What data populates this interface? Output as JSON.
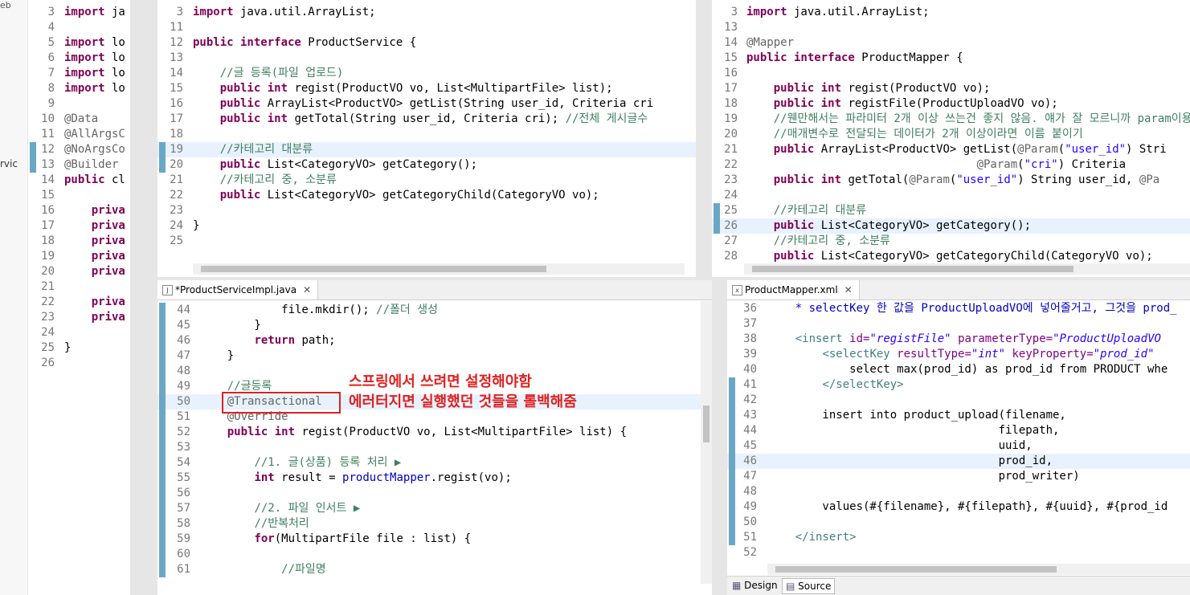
{
  "side_labels": {
    "top": "eb",
    "mid": "rvic"
  },
  "pane_a": {
    "lines": [
      {
        "n": "3",
        "t": "import ja",
        "kw": true
      },
      {
        "n": "4",
        "t": ""
      },
      {
        "n": "5",
        "t": "import lo",
        "kw": true
      },
      {
        "n": "6",
        "t": "import lo",
        "kw": true
      },
      {
        "n": "7",
        "t": "import lo",
        "kw": true
      },
      {
        "n": "8",
        "t": "import lo",
        "kw": true
      },
      {
        "n": "9",
        "t": ""
      },
      {
        "n": "10",
        "t": "@Data"
      },
      {
        "n": "11",
        "t": "@AllArgsC"
      },
      {
        "n": "12",
        "t": "@NoArgsCo"
      },
      {
        "n": "13",
        "t": "@Builder"
      },
      {
        "n": "14",
        "t": "public cl",
        "kw": true
      },
      {
        "n": "15",
        "t": ""
      },
      {
        "n": "16",
        "t": "    priva",
        "kw": true
      },
      {
        "n": "17",
        "t": "    priva",
        "kw": true
      },
      {
        "n": "18",
        "t": "    priva",
        "kw": true
      },
      {
        "n": "19",
        "t": "    priva",
        "kw": true
      },
      {
        "n": "20",
        "t": "    priva",
        "kw": true
      },
      {
        "n": "21",
        "t": ""
      },
      {
        "n": "22",
        "t": "    priva",
        "kw": true
      },
      {
        "n": "23",
        "t": "    priva",
        "kw": true
      },
      {
        "n": "24",
        "t": ""
      },
      {
        "n": "25",
        "t": "}"
      },
      {
        "n": "26",
        "t": ""
      }
    ]
  },
  "pane_b": {
    "lines": [
      {
        "n": "3",
        "h": "<span class=\"kw\">import</span> java.util.ArrayList;"
      },
      {
        "n": "11",
        "h": ""
      },
      {
        "n": "12",
        "h": "<span class=\"kw\">public interface</span> ProductService {"
      },
      {
        "n": "13",
        "h": ""
      },
      {
        "n": "14",
        "h": "    <span class=\"cm\">//글 등록(파일 업로드)</span>"
      },
      {
        "n": "15",
        "h": "    <span class=\"kw\">public int</span> regist(ProductVO vo, List&lt;MultipartFile&gt; list);"
      },
      {
        "n": "16",
        "h": "    <span class=\"kw\">public</span> ArrayList&lt;ProductVO&gt; getList(String user_id, Criteria cri"
      },
      {
        "n": "17",
        "h": "    <span class=\"kw\">public int</span> getTotal(String user_id, Criteria cri); <span class=\"cm\">//전체 게시글수</span>"
      },
      {
        "n": "18",
        "h": ""
      },
      {
        "n": "19",
        "h": "    <span class=\"cm\">//카테고리 대분류</span>"
      },
      {
        "n": "20",
        "h": "    <span class=\"kw\">public</span> List&lt;CategoryVO&gt; getCategory();"
      },
      {
        "n": "21",
        "h": "    <span class=\"cm\">//카테고리 중, 소분류</span>"
      },
      {
        "n": "22",
        "h": "    <span class=\"kw\">public</span> List&lt;CategoryVO&gt; getCategoryChild(CategoryVO vo);"
      },
      {
        "n": "23",
        "h": ""
      },
      {
        "n": "24",
        "h": "}"
      },
      {
        "n": "25",
        "h": ""
      }
    ]
  },
  "pane_c": {
    "lines": [
      {
        "n": "3",
        "h": "<span class=\"kw\">import</span> java.util.ArrayList;"
      },
      {
        "n": "13",
        "h": ""
      },
      {
        "n": "14",
        "h": "<span class=\"an\">@Mapper</span>"
      },
      {
        "n": "15",
        "h": "<span class=\"kw\">public interface</span> ProductMapper {"
      },
      {
        "n": "16",
        "h": ""
      },
      {
        "n": "17",
        "h": "    <span class=\"kw\">public int</span> regist(ProductVO vo);"
      },
      {
        "n": "18",
        "h": "    <span class=\"kw\">public int</span> registFile(ProductUploadVO vo);"
      },
      {
        "n": "19",
        "h": "    <span class=\"cm\">//웬만해서는 파라미터 2개 이상 쓰는건 좋지 않음. 얘가 잘 모르니까 param이용해</span>"
      },
      {
        "n": "20",
        "h": "    <span class=\"cm\">//매개변수로 전달되는 데이터가 2개 이상이라면 이름 붙이기</span>"
      },
      {
        "n": "21",
        "h": "    <span class=\"kw\">public</span> ArrayList&lt;ProductVO&gt; getList(<span class=\"an\">@Param</span>(<span class=\"st\">\"user_id\"</span>) Stri"
      },
      {
        "n": "22",
        "h": "                                  <span class=\"an\">@Param</span>(<span class=\"st\">\"cri\"</span>) Criteria"
      },
      {
        "n": "23",
        "h": "    <span class=\"kw\">public int</span> getTotal(<span class=\"an\">@Param</span>(<span class=\"st\">\"user_id\"</span>) String user_id, <span class=\"an\">@Pa</span>"
      },
      {
        "n": "24",
        "h": ""
      },
      {
        "n": "25",
        "h": "    <span class=\"cm\">//카테고리 대분류</span>"
      },
      {
        "n": "26",
        "h": "    <span class=\"kw\">public</span> List&lt;CategoryVO&gt; getCategory();"
      },
      {
        "n": "27",
        "h": "    <span class=\"cm\">//카테고리 중, 소분류</span>"
      },
      {
        "n": "28",
        "h": "    <span class=\"kw\">public</span> List&lt;CategoryVO&gt; getCategoryChild(CategoryVO vo);"
      }
    ]
  },
  "pane_d": {
    "tab_label": "*ProductServiceImpl.java",
    "lines": [
      {
        "n": "44",
        "h": "            file.mkdir(); <span class=\"cm\">//폴더 생성</span>"
      },
      {
        "n": "45",
        "h": "        }"
      },
      {
        "n": "46",
        "h": "        <span class=\"kw\">return</span> path;"
      },
      {
        "n": "47",
        "h": "    }"
      },
      {
        "n": "48",
        "h": ""
      },
      {
        "n": "49",
        "h": "    <span class=\"cm\">//글등록</span>"
      },
      {
        "n": "50",
        "h": "    <span class=\"an\">@Transactional</span>"
      },
      {
        "n": "51",
        "h": "    <span class=\"an\">@Override</span>"
      },
      {
        "n": "52",
        "h": "    <span class=\"kw\">public int</span> regist(ProductVO vo, List&lt;MultipartFile&gt; list) {"
      },
      {
        "n": "53",
        "h": ""
      },
      {
        "n": "54",
        "h": "        <span class=\"cm\">//1. 글(상품) 등록 처리 ▶</span>"
      },
      {
        "n": "55",
        "h": "        <span class=\"kw\">int</span> result = <span class=\"fd\">productMapper</span>.regist(vo);"
      },
      {
        "n": "56",
        "h": ""
      },
      {
        "n": "57",
        "h": "        <span class=\"cm\">//2. 파일 인서트 ▶</span>"
      },
      {
        "n": "58",
        "h": "        <span class=\"cm\">//반복처리</span>"
      },
      {
        "n": "59",
        "h": "        <span class=\"kw\">for</span>(MultipartFile file : list) {"
      },
      {
        "n": "60",
        "h": ""
      },
      {
        "n": "61",
        "h": "            <span class=\"cm\">//파일명</span>"
      }
    ],
    "annotation_line1": "스프링에서 쓰려면 설정해야함",
    "annotation_line2": "에러터지면 실행했던 것들을 롤백해줌"
  },
  "pane_e": {
    "tab_label": "ProductMapper.xml",
    "lines": [
      {
        "n": "36",
        "h": "    <span class=\"fd\">* selectKey 한 값을 ProductUploadVO에 넣어줄거고, 그것을 prod_</span>"
      },
      {
        "n": "37",
        "h": ""
      },
      {
        "n": "38",
        "h": "    <span class=\"tg\">&lt;insert</span> <span class=\"at\">id=</span><span class=\"av\">\"registFile\"</span> <span class=\"at\">parameterType=</span><span class=\"av\">\"ProductUploadVO</span>"
      },
      {
        "n": "39",
        "h": "        <span class=\"tg\">&lt;selectKey</span> <span class=\"at\">resultType=</span><span class=\"av\">\"int\"</span> <span class=\"at\">keyProperty=</span><span class=\"av\">\"prod_id\"</span>"
      },
      {
        "n": "40",
        "h": "            select max(prod_id) as prod_id from PRODUCT whe"
      },
      {
        "n": "41",
        "h": "        <span class=\"tg\">&lt;/selectKey&gt;</span>"
      },
      {
        "n": "42",
        "h": ""
      },
      {
        "n": "43",
        "h": "        insert into product_upload(filename,"
      },
      {
        "n": "44",
        "h": "                                  filepath,"
      },
      {
        "n": "45",
        "h": "                                  uuid,"
      },
      {
        "n": "46",
        "h": "                                  prod_id,"
      },
      {
        "n": "47",
        "h": "                                  prod_writer)"
      },
      {
        "n": "48",
        "h": ""
      },
      {
        "n": "49",
        "h": "        values(#{filename}, #{filepath}, #{uuid}, #{prod_id"
      },
      {
        "n": "50",
        "h": ""
      },
      {
        "n": "51",
        "h": "    <span class=\"tg\">&lt;/insert&gt;</span>"
      },
      {
        "n": "52",
        "h": ""
      }
    ],
    "bottom_tabs": [
      "Design",
      "Source"
    ]
  }
}
